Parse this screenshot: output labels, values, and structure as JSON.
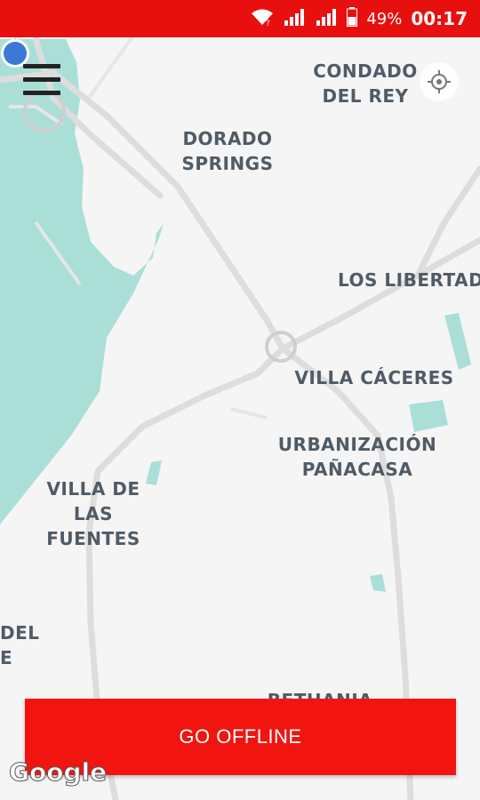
{
  "status": {
    "battery_pct": "49%",
    "time": "00:17"
  },
  "map": {
    "places": [
      {
        "name": "CONDADO\nDEL REY"
      },
      {
        "name": "DORADO\nSPRINGS"
      },
      {
        "name": "LOS LIBERTADO"
      },
      {
        "name": "VILLA CÁCERES"
      },
      {
        "name": "URBANIZACIÓN\nPAÑACASA"
      },
      {
        "name": "VILLA DE\nLAS FUENTES"
      },
      {
        "name": "DEL\nE"
      },
      {
        "name": "BETHANIA"
      }
    ],
    "attribution": "Google"
  },
  "actions": {
    "go_offline": "GO OFFLINE"
  },
  "colors": {
    "accent": "#e8100f",
    "water": "#aadfd8",
    "road": "#dcdcdc",
    "location": "#3b78d8"
  }
}
